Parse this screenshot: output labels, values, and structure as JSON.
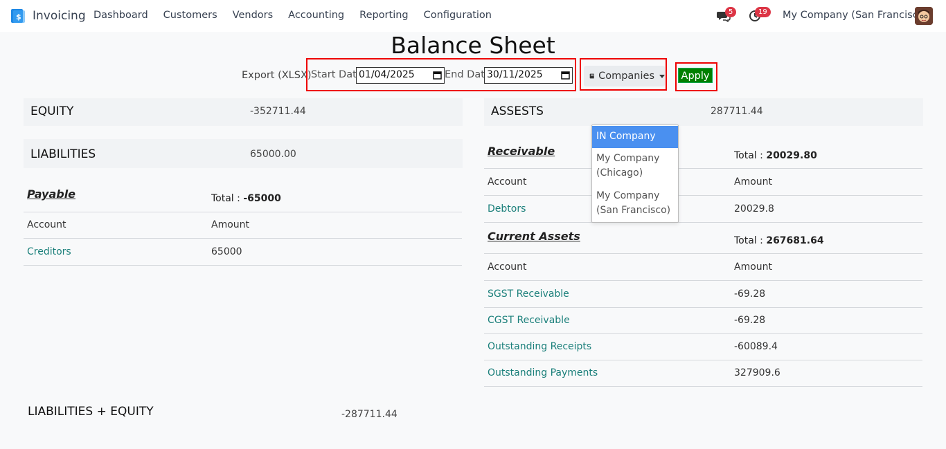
{
  "navbar": {
    "app_name": "Invoicing",
    "menu": [
      "Dashboard",
      "Customers",
      "Vendors",
      "Accounting",
      "Reporting",
      "Configuration"
    ],
    "chat_badge": "5",
    "activity_badge": "19",
    "company": "My Company (San Francisco)"
  },
  "page_title": "Balance Sheet",
  "toolbar": {
    "export_label": "Export (XLSX)",
    "start_date_label": "Start Date",
    "start_date_value": "01/04/2025",
    "end_date_label": "End Date",
    "end_date_value": "30/11/2025",
    "companies_label": "Companies",
    "apply_label": "Apply"
  },
  "companies_dropdown": {
    "options": [
      "IN Company",
      "My Company (Chicago)",
      "My Company (San Francisco)"
    ],
    "selected": "IN Company"
  },
  "equity": {
    "title": "EQUITY",
    "value": "-352711.44"
  },
  "liabilities": {
    "title": "LIABILITIES",
    "value": "65000.00",
    "groups": [
      {
        "name": "Payable",
        "total_label": "Total :",
        "total_value": "-65000",
        "col_account": "Account",
        "col_amount": "Amount",
        "rows": [
          {
            "account": "Creditors",
            "amount": "65000"
          }
        ]
      }
    ]
  },
  "assets": {
    "title": "ASSESTS",
    "value": "287711.44",
    "groups": [
      {
        "name": "Receivable",
        "total_label": "Total :",
        "total_value": "20029.80",
        "col_account": "Account",
        "col_amount": "Amount",
        "rows": [
          {
            "account": "Debtors",
            "amount": "20029.8"
          }
        ]
      },
      {
        "name": "Current Assets",
        "total_label": "Total :",
        "total_value": "267681.64",
        "col_account": "Account",
        "col_amount": "Amount",
        "rows": [
          {
            "account": "SGST Receivable",
            "amount": "-69.28"
          },
          {
            "account": "CGST Receivable",
            "amount": "-69.28"
          },
          {
            "account": "Outstanding Receipts",
            "amount": "-60089.4"
          },
          {
            "account": "Outstanding Payments",
            "amount": "327909.6"
          }
        ]
      }
    ]
  },
  "liabilities_equity": {
    "title": "LIABILITIES + EQUITY",
    "value": "-287711.44"
  },
  "colors": {
    "accent_link": "#1a7f7a",
    "apply_green": "#008000",
    "highlight_red": "#e00000",
    "dropdown_active": "#4a90f0"
  }
}
